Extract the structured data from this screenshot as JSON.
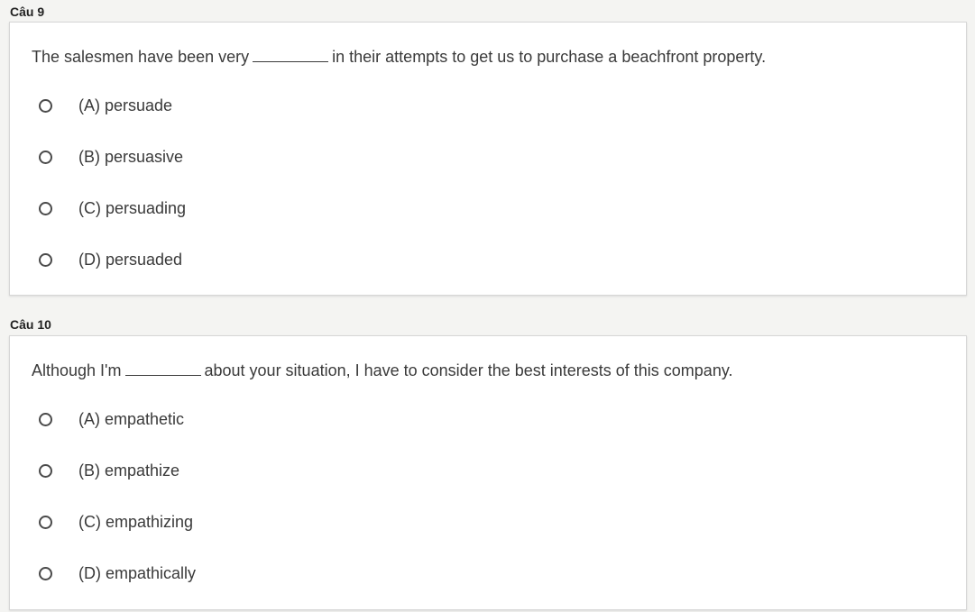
{
  "questions": [
    {
      "heading": "Câu 9",
      "prompt_before": "The salesmen have been very",
      "prompt_after": "in their attempts to get us to purchase a beachfront property.",
      "options": [
        {
          "label": "(A) persuade"
        },
        {
          "label": "(B) persuasive"
        },
        {
          "label": "(C) persuading"
        },
        {
          "label": "(D) persuaded"
        }
      ]
    },
    {
      "heading": "Câu 10",
      "prompt_before": "Although I'm",
      "prompt_after": "about your situation, I have to consider the best interests of this company.",
      "options": [
        {
          "label": "(A) empathetic"
        },
        {
          "label": "(B) empathize"
        },
        {
          "label": "(C) empathizing"
        },
        {
          "label": "(D) empathically"
        }
      ]
    }
  ],
  "colors": {
    "page_background": "#f4f4f2",
    "card_background": "#ffffff",
    "text": "#3a3a3a",
    "radio_border": "#4a4a4a"
  },
  "icons": {
    "radio": "radio-button-unchecked-icon"
  }
}
